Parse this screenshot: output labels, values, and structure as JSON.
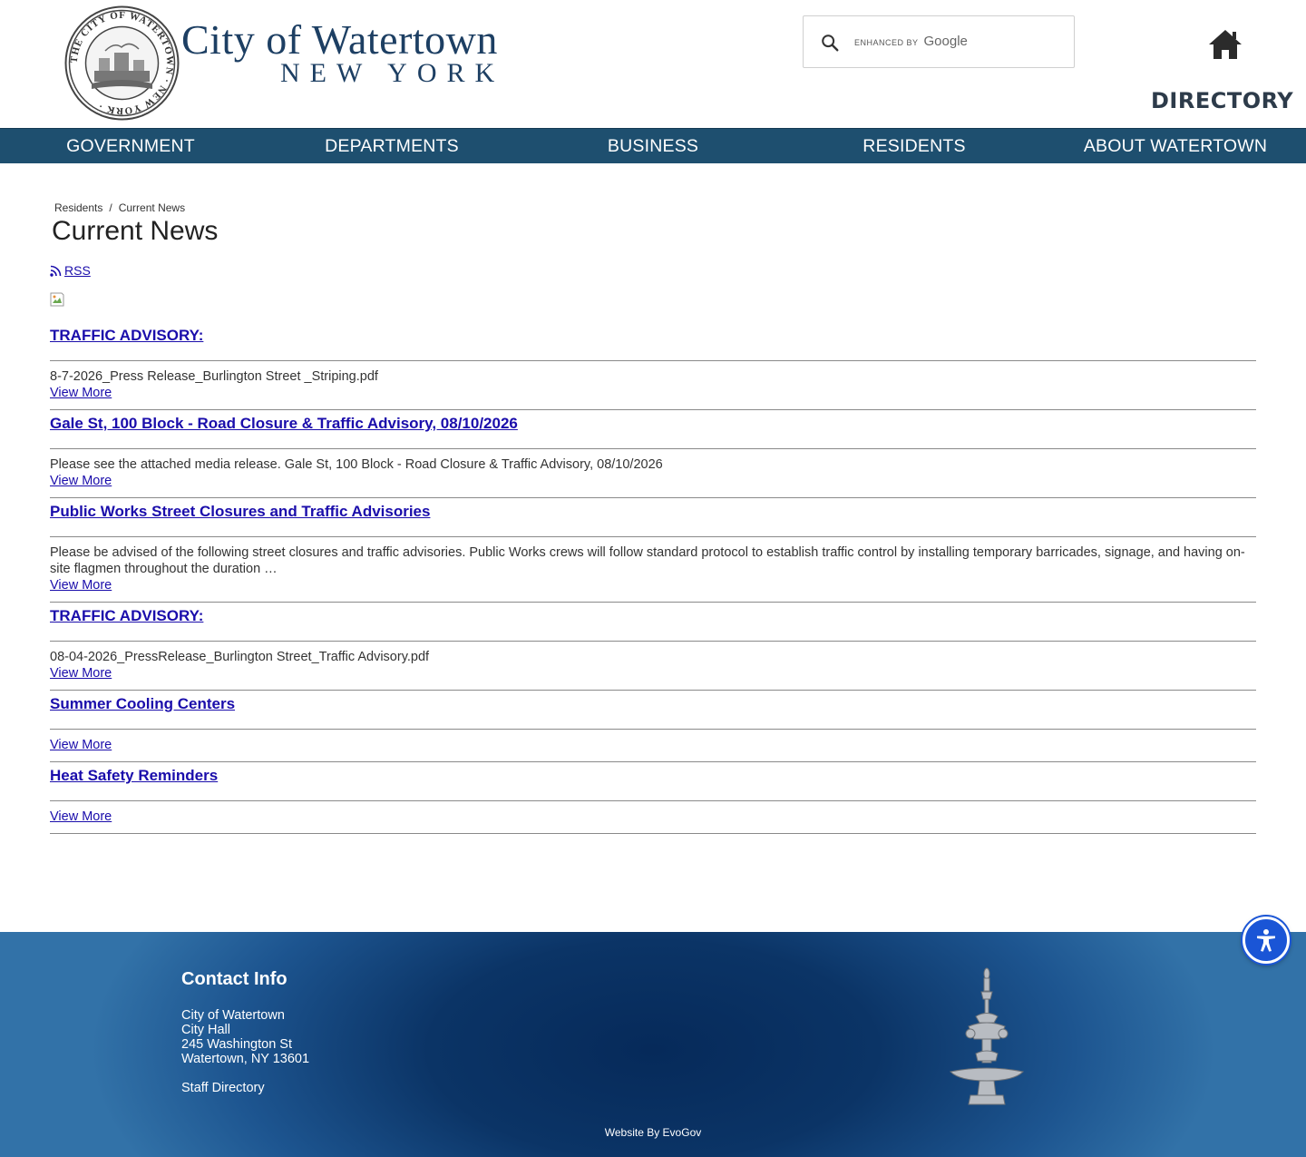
{
  "header": {
    "logo_title": "City of Watertown",
    "logo_subtitle": "NEW YORK",
    "seal_text": "THE CITY OF WATERTOWN NEW YORK",
    "directory_label": "DIRECTORY"
  },
  "search": {
    "value": "",
    "enhanced_by": "enhanced by",
    "brand": "Google",
    "icon": "search-icon"
  },
  "nav": {
    "items": [
      "GOVERNMENT",
      "DEPARTMENTS",
      "BUSINESS",
      "RESIDENTS",
      "ABOUT WATERTOWN"
    ]
  },
  "breadcrumb": {
    "items": [
      "Residents",
      "Current News"
    ],
    "separator": "/"
  },
  "page": {
    "title": "Current News",
    "rss_label": "RSS"
  },
  "news": [
    {
      "title": "TRAFFIC ADVISORY:",
      "description": "8-7-2026_Press Release_Burlington Street _Striping.pdf",
      "link": "View More"
    },
    {
      "title": "Gale St, 100 Block - Road Closure & Traffic Advisory, 08/10/2026",
      "description": "Please see the attached media release. Gale St, 100 Block - Road Closure & Traffic Advisory, 08/10/2026",
      "link": "View More"
    },
    {
      "title": "Public Works Street Closures and Traffic Advisories",
      "description": "Please be advised of the following street closures and traffic advisories. Public Works crews will follow standard protocol to establish traffic control by installing temporary barricades, signage, and having on-site flagmen throughout the duration …",
      "link": "View More"
    },
    {
      "title": "TRAFFIC ADVISORY:",
      "description": "08-04-2026_PressRelease_Burlington Street_Traffic Advisory.pdf",
      "link": "View More"
    },
    {
      "title": "Summer Cooling Centers",
      "description": "",
      "link": "View More"
    },
    {
      "title": "Heat Safety Reminders",
      "description": "",
      "link": "View More"
    }
  ],
  "footer": {
    "contact_title": "Contact Info",
    "contact_lines": [
      "City of Watertown",
      "City Hall",
      "245 Washington St",
      "Watertown, NY 13601"
    ],
    "staff_directory": "Staff Directory",
    "credit": "Website By EvoGov"
  },
  "colors": {
    "nav_bg": "#1e4f6f",
    "link": "#1a0dab",
    "brand": "#1d3f63",
    "accessibility": "#1a55d6"
  }
}
